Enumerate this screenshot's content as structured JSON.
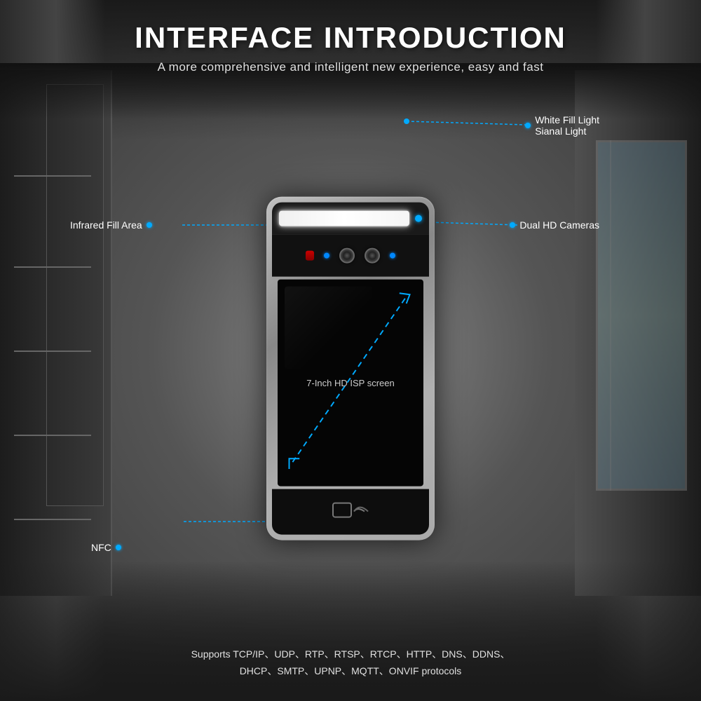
{
  "header": {
    "main_title": "INTERFACE INTRODUCTION",
    "subtitle": "A more comprehensive and intelligent new experience, easy and fast"
  },
  "annotations": {
    "white_fill_light": "White Fill Light",
    "signal_light": "Sianal Light",
    "infrared_fill_area": "Infrared Fill Area",
    "dual_hd_cameras": "Dual HD Cameras",
    "screen_label": "7-Inch HD ISP screen",
    "nfc": "NFC"
  },
  "footer": {
    "line1": "Supports TCP/IP、UDP、RTP、RTSP、RTCP、HTTP、DNS、DDNS、",
    "line2": "DHCP、SMTP、UPNP、MQTT、ONVIF protocols"
  },
  "colors": {
    "accent": "#00aaff",
    "title_white": "#ffffff",
    "subtitle_light": "#e0e0e0",
    "device_bg": "#aaaaaa",
    "screen_bg": "#050505"
  }
}
